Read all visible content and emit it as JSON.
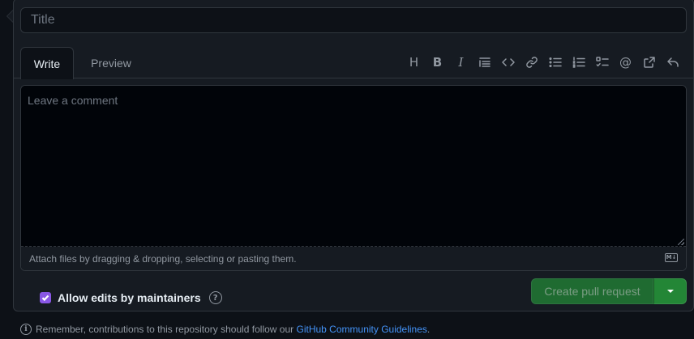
{
  "title_input": {
    "placeholder": "Title",
    "value": ""
  },
  "tabs": [
    {
      "label": "Write",
      "active": true
    },
    {
      "label": "Preview",
      "active": false
    }
  ],
  "toolbar": [
    {
      "icon": "heading-icon",
      "glyph": "H"
    },
    {
      "icon": "bold-icon",
      "glyph": "B"
    },
    {
      "icon": "italic-icon",
      "glyph": "I"
    },
    {
      "icon": "quote-icon"
    },
    {
      "icon": "code-icon"
    },
    {
      "icon": "link-icon"
    },
    {
      "icon": "unordered-list-icon"
    },
    {
      "icon": "ordered-list-icon"
    },
    {
      "icon": "task-list-icon"
    },
    {
      "icon": "mention-icon",
      "glyph": "@"
    },
    {
      "icon": "cross-reference-icon"
    },
    {
      "icon": "reply-icon"
    }
  ],
  "comment": {
    "placeholder": "Leave a comment",
    "value": ""
  },
  "attach": {
    "text": "Attach files by dragging & dropping, selecting or pasting them.",
    "markdown_badge": "M↓"
  },
  "allow_edits": {
    "label": "Allow edits by maintainers",
    "checked": true,
    "help_glyph": "?"
  },
  "create_button": {
    "label": "Create pull request"
  },
  "footer": {
    "info_glyph": "i",
    "text": "Remember, contributions to this repository should follow our ",
    "link_text": "GitHub Community Guidelines",
    "suffix": "."
  },
  "colors": {
    "background": "#0d1117",
    "panel": "#161b22",
    "border": "#30363d",
    "primary_button": "#238636",
    "checkbox": "#8957e5",
    "link": "#4493f8",
    "muted_text": "#9198a1"
  }
}
